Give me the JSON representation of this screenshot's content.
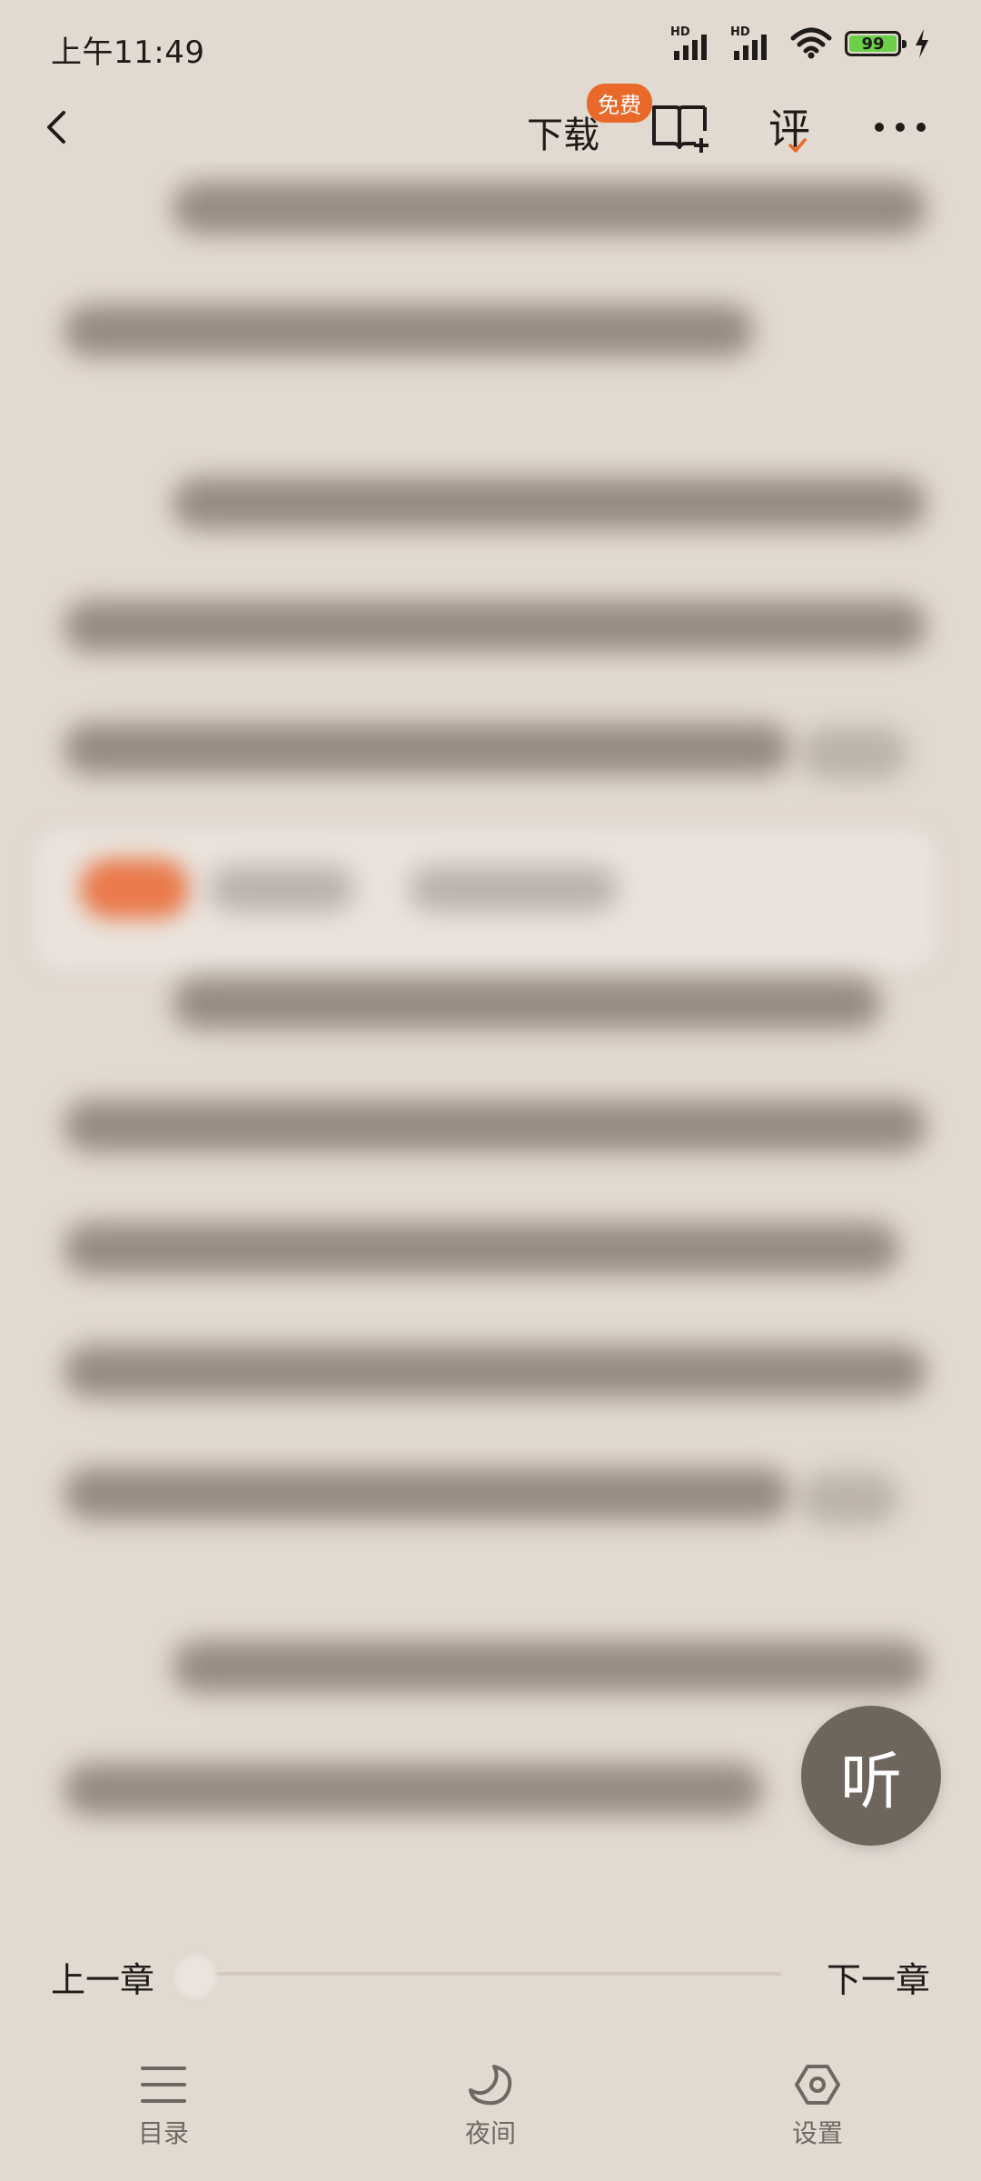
{
  "status_bar": {
    "time": "上午11:49",
    "network_label": "HD",
    "battery": "99"
  },
  "toolbar": {
    "download_label": "下载",
    "free_badge": "免费",
    "review_label": "评"
  },
  "reader": {
    "listen_label": "听"
  },
  "chapter_nav": {
    "prev_label": "上一章",
    "next_label": "下一章"
  },
  "bottom_bar": {
    "items": [
      {
        "label": "目录",
        "icon": "menu-icon"
      },
      {
        "label": "夜间",
        "icon": "moon-icon"
      },
      {
        "label": "设置",
        "icon": "settings-icon"
      }
    ]
  },
  "colors": {
    "background": "#e2d9d1",
    "accent": "#e8692a",
    "listen_button": "#6e655d"
  }
}
